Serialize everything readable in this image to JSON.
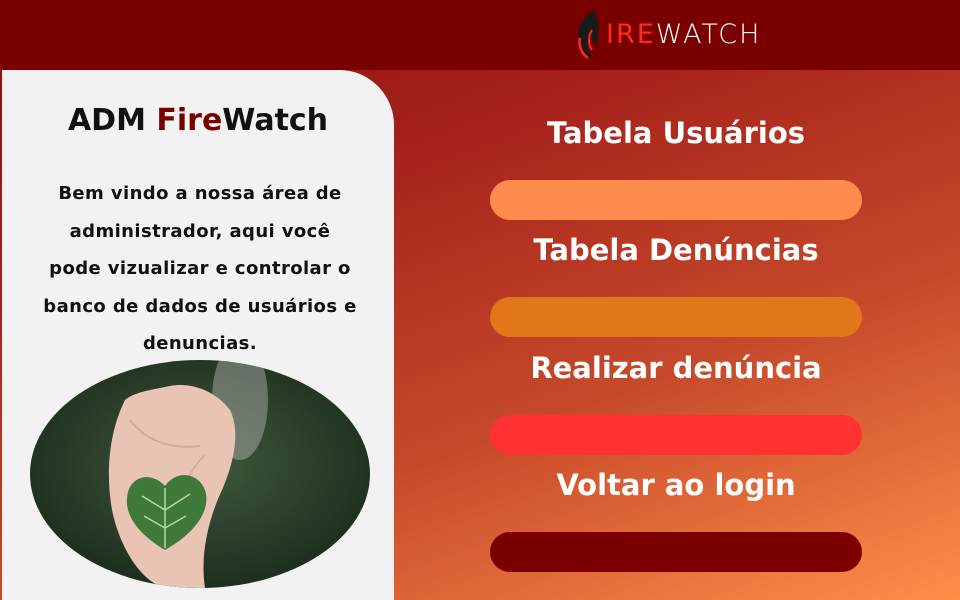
{
  "header": {
    "logo": {
      "icon": "flame-icon",
      "part1": "IRE",
      "part2": "WATCH",
      "lead_letter": "F"
    }
  },
  "sidebar": {
    "title_prefix": "ADM ",
    "title_accent": "Fire",
    "title_suffix": "Watch",
    "description_lines": [
      "Bem vindo a nossa área de",
      "administrador, aqui você",
      "pode vizualizar e controlar o",
      "banco de dados de usuários e",
      "denuncias."
    ],
    "image": "hand-holding-heart-leaf"
  },
  "menu": [
    {
      "label": "Tabela Usuários",
      "button_color": "#ff8c4c"
    },
    {
      "label": "Tabela Denúncias",
      "button_color": "#e2761a"
    },
    {
      "label": "Realizar denúncia",
      "button_color": "#ff3131"
    },
    {
      "label": "Voltar ao login",
      "button_color": "#7a0000"
    }
  ],
  "colors": {
    "header_bg": "#7a0000",
    "accent": "#7a0000",
    "panel_bg": "#f2f2f2"
  }
}
